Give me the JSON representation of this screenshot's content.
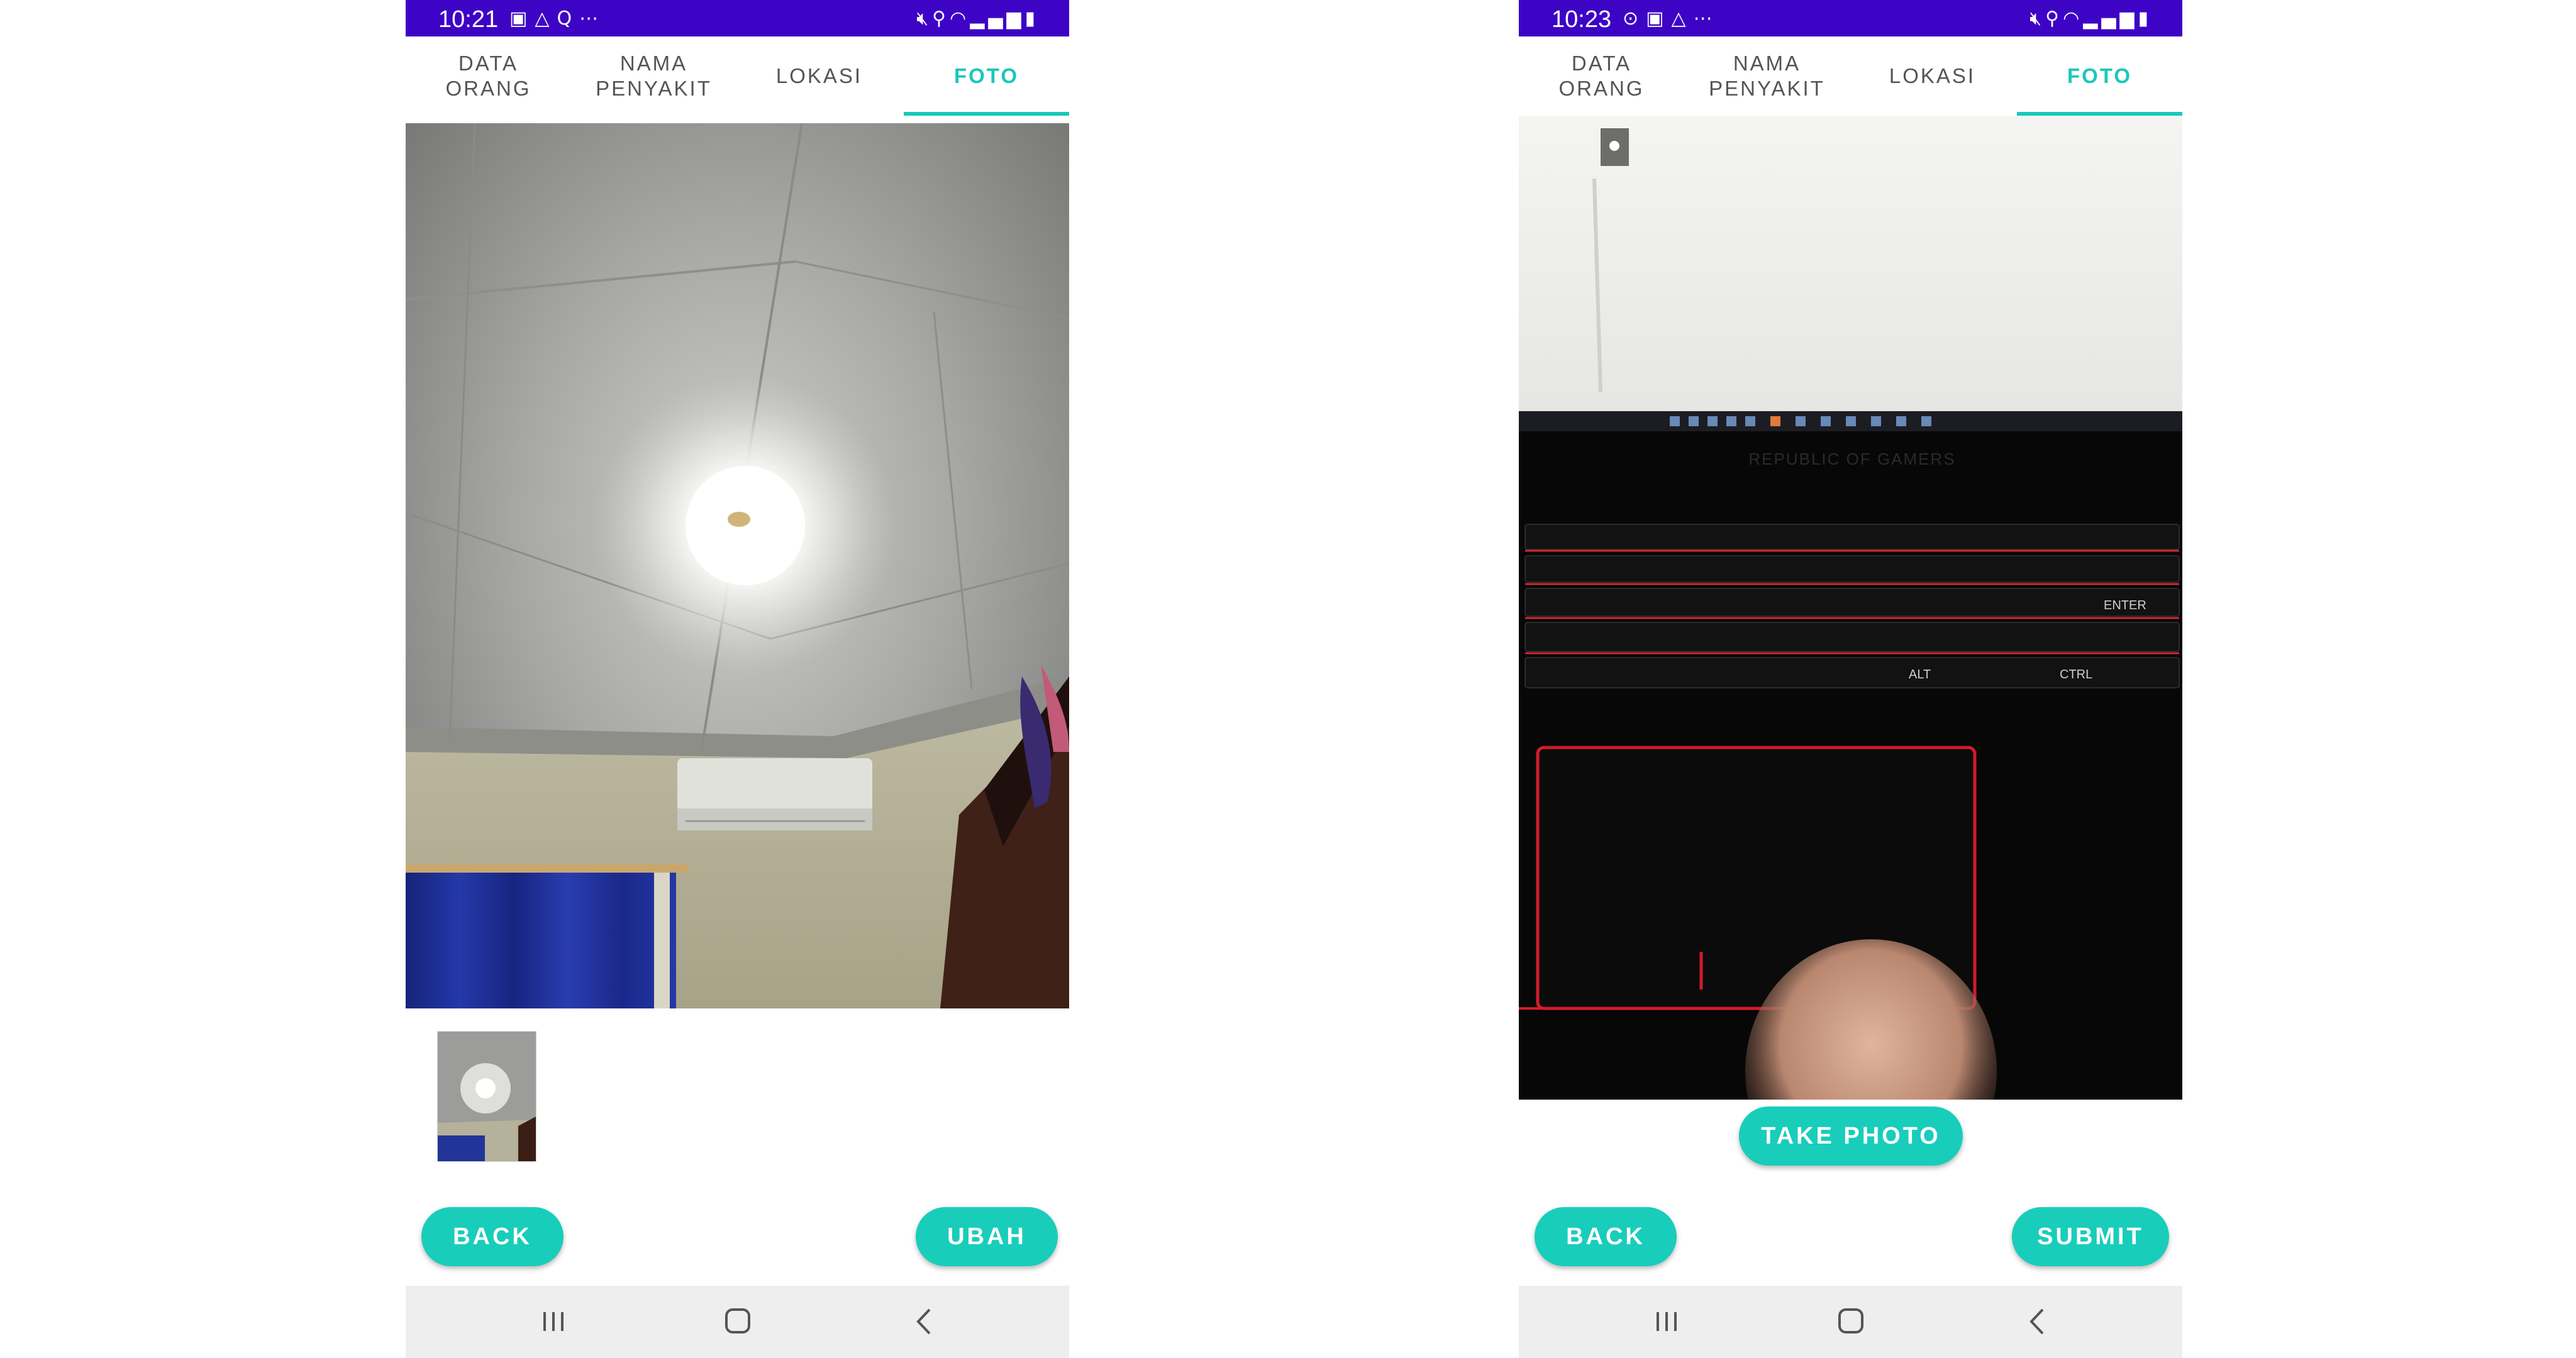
{
  "colors": {
    "status_bar": "#3d04c6",
    "accent": "#19c8b9",
    "button": "#19cdbb",
    "tab_inactive": "#555555",
    "nav_bar": "#eeeeee"
  },
  "left": {
    "status": {
      "time": "10:21",
      "left_icons": [
        "gallery-icon",
        "drive-icon",
        "search-app-icon",
        "more-dots-icon"
      ],
      "right_icons": [
        "mute-icon",
        "location-icon",
        "wifi-icon",
        "signal-icon",
        "battery-icon"
      ]
    },
    "tabs": [
      {
        "label": "DATA\nORANG",
        "active": false
      },
      {
        "label": "NAMA\nPENYAKIT",
        "active": false
      },
      {
        "label": "LOKASI",
        "active": false
      },
      {
        "label": "FOTO",
        "active": true
      }
    ],
    "buttons": {
      "back": "BACK",
      "action": "UBAH"
    },
    "nav": [
      "recent-apps-icon",
      "home-icon",
      "back-arrow-icon"
    ]
  },
  "right": {
    "status": {
      "time": "10:23",
      "left_icons": [
        "game-controller-icon",
        "gallery-icon",
        "drive-icon",
        "more-dots-icon"
      ],
      "right_icons": [
        "mute-icon",
        "location-icon",
        "wifi-icon",
        "signal-icon",
        "battery-charging-icon"
      ]
    },
    "tabs": [
      {
        "label": "DATA\nORANG",
        "active": false
      },
      {
        "label": "NAMA\nPENYAKIT",
        "active": false
      },
      {
        "label": "LOKASI",
        "active": false
      },
      {
        "label": "FOTO",
        "active": true
      }
    ],
    "buttons": {
      "take_photo": "TAKE PHOTO",
      "back": "BACK",
      "action": "SUBMIT"
    },
    "photo_text": {
      "brand": "REPUBLIC OF GAMERS",
      "enter_key": "ENTER",
      "alt_key": "ALT",
      "ctrl_key": "CTRL"
    },
    "nav": [
      "recent-apps-icon",
      "home-icon",
      "back-arrow-icon"
    ]
  }
}
